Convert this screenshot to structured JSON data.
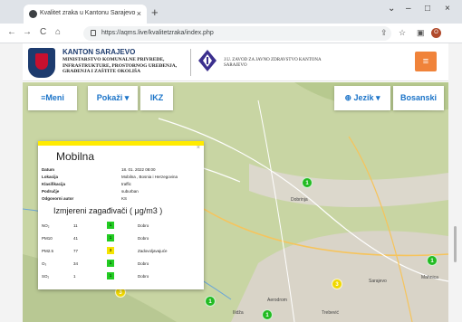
{
  "browser": {
    "tab_title": "Kvalitet zraka u Kantonu Sarajevo",
    "tab_close": "×",
    "new_tab": "+",
    "url": "https://aqms.live/kvalitetzraka/index.php",
    "window_controls": [
      "⌄",
      "–",
      "□",
      "×"
    ],
    "nav": {
      "back": "←",
      "forward": "→",
      "reload": "C",
      "home": "⌂"
    },
    "profile_initial": "O",
    "action_icons": [
      "⇪",
      "☆",
      "▣"
    ]
  },
  "header": {
    "title": "KANTON SARAJEVO",
    "ministry": "MINISTARSTVO KOMUNALNE PRIVREDE, INFRASTRUKTURE, PROSTORNOG UREĐENJA, GRAĐENJA I ZAŠTITE OKOLIŠA",
    "zavod": "J.U. ZAVOD ZA JAVNO ZDRAVSTVO KANTONA SARAJEVO",
    "menu_icon": "≡"
  },
  "navbar": {
    "meni": "≡Meni",
    "pokazi": "Pokaži ▾",
    "ikz": "IKZ",
    "jezik": "⊕ Jezik ▾",
    "bosanski": "Bosanski"
  },
  "popup": {
    "close": "×",
    "title": "Mobilna",
    "details": [
      {
        "label": "Datum",
        "value": "18. 01. 2022 08:00"
      },
      {
        "label": "Lokacija",
        "value": "Mobilna , Bosnia i Herzegovina"
      },
      {
        "label": "Klasifikacija",
        "value": "traffic"
      },
      {
        "label": "Područje",
        "value": "suburban"
      },
      {
        "label": "Odgovorni autor",
        "value": "KS"
      }
    ],
    "subtitle": "Izmjereni zagađivači ( μg/m3 )",
    "pollutants": [
      {
        "name": "NO₂",
        "value": "11",
        "index": "1",
        "status": "Dobro",
        "color": "#22cc22"
      },
      {
        "name": "PM10",
        "value": "41",
        "index": "1",
        "status": "Dobro",
        "color": "#22cc22"
      },
      {
        "name": "PM2.5",
        "value": "77",
        "index": "3",
        "status": "Zadovoljavajuće",
        "color": "#f5e400"
      },
      {
        "name": "O₃",
        "value": "34",
        "index": "1",
        "status": "Dobro",
        "color": "#22cc22"
      },
      {
        "name": "SO₂",
        "value": "1",
        "index": "1",
        "status": "Dobro",
        "color": "#22cc22"
      }
    ]
  },
  "map": {
    "markers": [
      {
        "label": "1",
        "color": "#22bb22"
      },
      {
        "label": "1",
        "color": "#22bb22"
      },
      {
        "label": "1",
        "color": "#22bb22"
      },
      {
        "label": "1",
        "color": "#22bb22"
      },
      {
        "label": "3",
        "color": "#f0d800"
      },
      {
        "label": "3",
        "color": "#f0d800"
      }
    ],
    "place_labels": [
      "Dobrinja",
      "Sarajevo",
      "Aerodrom",
      "Ilidža",
      "Mahnica",
      "Trebević"
    ]
  }
}
